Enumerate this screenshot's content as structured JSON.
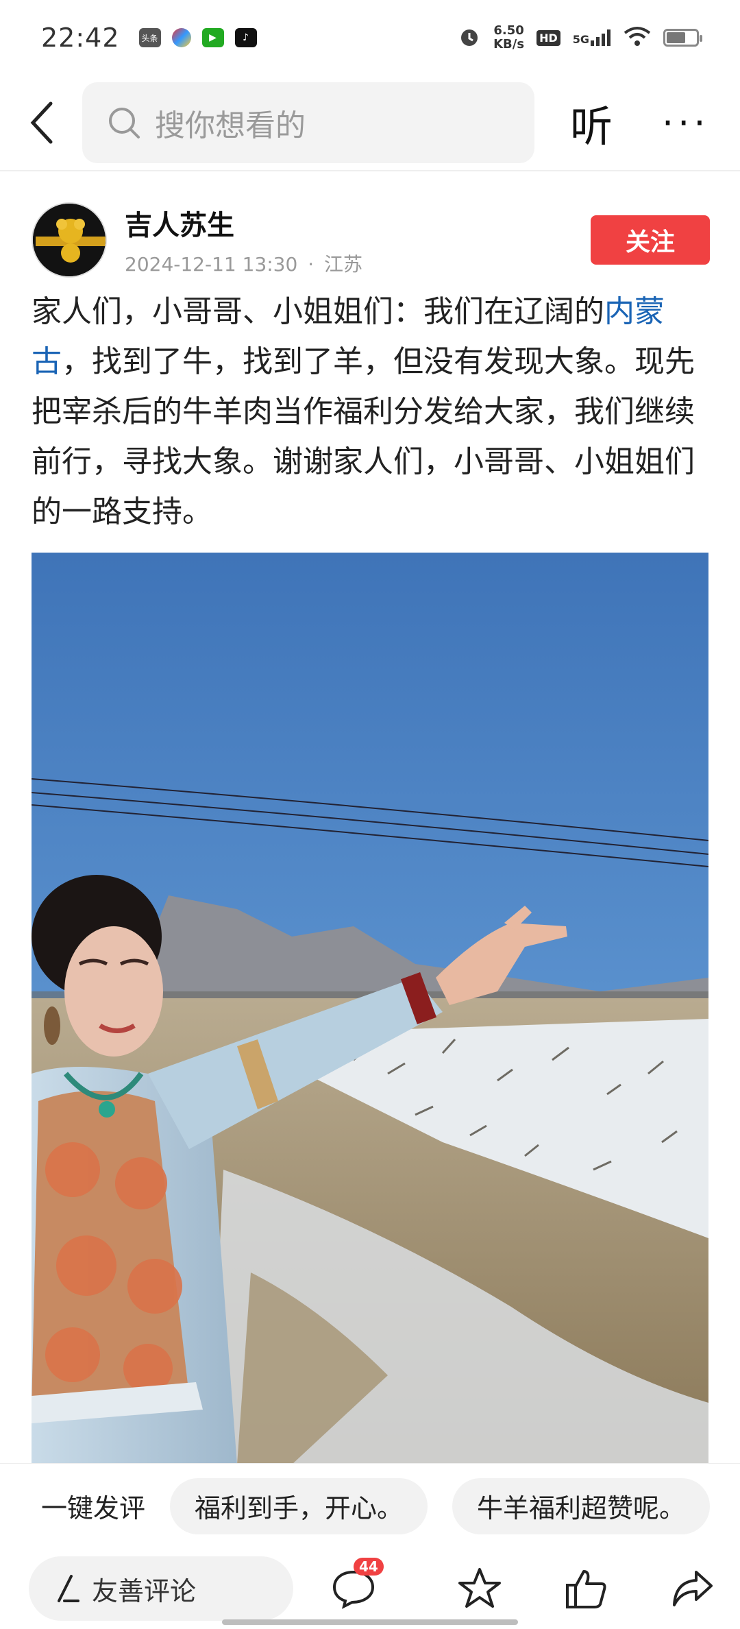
{
  "status_bar": {
    "time": "22:42",
    "app_icons": [
      "toutiao-app-icon",
      "color-app-icon",
      "video-app-icon",
      "tiktok-app-icon"
    ],
    "app_badge_text": "头条",
    "net_speed_value": "6.50",
    "net_speed_unit": "KB/s",
    "hd_label": "HD",
    "network_label": "5G",
    "battery_level": 0.62
  },
  "header": {
    "search_placeholder": "搜你想看的",
    "listen_label": "听",
    "more_label": "···"
  },
  "post": {
    "author_name": "吉人苏生",
    "date": "2024-12-11 13:30",
    "separator": "·",
    "location": "江苏",
    "follow_label": "关注",
    "text_before_link": "家人们，小哥哥、小姐姐们：我们在辽阔的",
    "link_text": "内蒙古",
    "text_after_link": "，找到了牛，找到了羊，但没有发现大象。现先把宰杀后的牛羊肉当作福利分发给大家，我们继续前行，寻找大象。谢谢家人们，小哥哥、小姐姐们的一路支持。"
  },
  "quick_comments": {
    "label": "一键发评",
    "chips": [
      "福利到手，开心。",
      "牛羊福利超赞呢。"
    ]
  },
  "action_bar": {
    "comment_placeholder": "友善评论",
    "comment_count": "44"
  },
  "colors": {
    "accent_red": "#f04142",
    "link_blue": "#1a64b5"
  }
}
